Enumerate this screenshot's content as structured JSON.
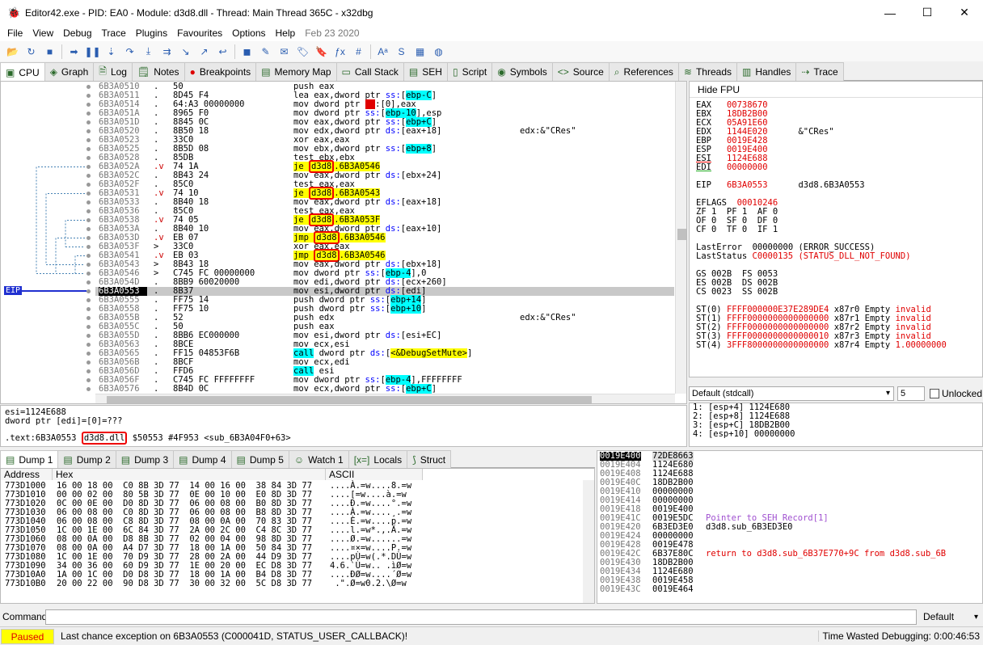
{
  "window": {
    "title": "Editor42.exe - PID: EA0 - Module: d3d8.dll - Thread: Main Thread 365C - x32dbg",
    "min": "—",
    "max": "☐",
    "close": "✕"
  },
  "menu": [
    "File",
    "View",
    "Debug",
    "Trace",
    "Plugins",
    "Favourites",
    "Options",
    "Help"
  ],
  "menu_date": "Feb 23 2020",
  "toolbar_icons": [
    "open-icon",
    "restart-icon",
    "stop-icon",
    "run-icon",
    "pause-icon",
    "step-into-icon",
    "step-over-icon",
    "run-to-user-icon",
    "animate-icon",
    "trace-into-icon",
    "trace-over-icon",
    "execute-till-return-icon",
    "scylla-icon",
    "patch-icon",
    "comment-icon",
    "label-icon",
    "bookmark-icon",
    "function-icon",
    "hash-icon",
    "font-icon",
    "string-icon",
    "calculator-icon",
    "help-icon"
  ],
  "tabs": [
    "CPU",
    "Graph",
    "Log",
    "Notes",
    "Breakpoints",
    "Memory Map",
    "Call Stack",
    "SEH",
    "Script",
    "Symbols",
    "Source",
    "References",
    "Threads",
    "Handles",
    "Trace"
  ],
  "disasm": [
    {
      "addr": "6B3A0510",
      "mk": ".",
      "bytes": "50",
      "instr": [
        [
          "push eax",
          ""
        ]
      ],
      "cmt": ""
    },
    {
      "addr": "6B3A0511",
      "mk": ".",
      "bytes": "8D45 F4",
      "instr": [
        [
          "lea eax,dword ptr ",
          ""
        ],
        [
          "ss:",
          "seg"
        ],
        [
          "[",
          ""
        ],
        [
          "ebp-C",
          "hl-c"
        ],
        [
          "]",
          ""
        ]
      ],
      "cmt": ""
    },
    {
      "addr": "6B3A0514",
      "mk": ".",
      "bytes": "64:A3 00000000",
      "instr": [
        [
          "mov dword ptr ",
          ""
        ],
        [
          "fs",
          "redbg"
        ],
        [
          ":[0],eax",
          ""
        ]
      ],
      "cmt": ""
    },
    {
      "addr": "6B3A051A",
      "mk": ".",
      "bytes": "8965 F0",
      "instr": [
        [
          "mov dword ptr ",
          ""
        ],
        [
          "ss:",
          "seg"
        ],
        [
          "[",
          ""
        ],
        [
          "ebp-10",
          "hl-c"
        ],
        [
          "],esp",
          ""
        ]
      ],
      "cmt": ""
    },
    {
      "addr": "6B3A051D",
      "mk": ".",
      "bytes": "8845 0C",
      "instr": [
        [
          "mov eax,dword ptr ",
          ""
        ],
        [
          "ss:",
          "seg"
        ],
        [
          "[",
          ""
        ],
        [
          "ebp+C",
          "hl-c"
        ],
        [
          "]",
          ""
        ]
      ],
      "cmt": ""
    },
    {
      "addr": "6B3A0520",
      "mk": ".",
      "bytes": "8B50 18",
      "instr": [
        [
          "mov edx,dword ptr ",
          ""
        ],
        [
          "ds:",
          "seg"
        ],
        [
          "[eax+18]",
          ""
        ]
      ],
      "cmt": "edx:&\"CRes\""
    },
    {
      "addr": "6B3A0523",
      "mk": ".",
      "bytes": "33C0",
      "instr": [
        [
          "xor eax,eax",
          ""
        ]
      ],
      "cmt": ""
    },
    {
      "addr": "6B3A0525",
      "mk": ".",
      "bytes": "8B5D 08",
      "instr": [
        [
          "mov ebx,dword ptr ",
          ""
        ],
        [
          "ss:",
          "seg"
        ],
        [
          "[",
          ""
        ],
        [
          "ebp+8",
          "hl-c"
        ],
        [
          "]",
          ""
        ]
      ],
      "cmt": ""
    },
    {
      "addr": "6B3A0528",
      "mk": ".",
      "bytes": "85DB",
      "instr": [
        [
          "test ebx,ebx",
          ""
        ]
      ],
      "cmt": ""
    },
    {
      "addr": "6B3A052A",
      "mk": ".v",
      "bytes": "74 1A",
      "instr": [
        [
          "je ",
          "jk"
        ],
        [
          "d3d8",
          "box"
        ],
        [
          ".6B3A0546",
          "hl-y"
        ]
      ],
      "cmt": ""
    },
    {
      "addr": "6B3A052C",
      "mk": ".",
      "bytes": "8B43 24",
      "instr": [
        [
          "mov eax,dword ptr ",
          ""
        ],
        [
          "ds:",
          "seg"
        ],
        [
          "[ebx+24]",
          ""
        ]
      ],
      "cmt": ""
    },
    {
      "addr": "6B3A052F",
      "mk": ".",
      "bytes": "85C0",
      "instr": [
        [
          "test eax,eax",
          ""
        ]
      ],
      "cmt": ""
    },
    {
      "addr": "6B3A0531",
      "mk": ".v",
      "bytes": "74 10",
      "instr": [
        [
          "je ",
          "jk"
        ],
        [
          "d3d8",
          "box"
        ],
        [
          ".6B3A0543",
          "hl-y"
        ]
      ],
      "cmt": ""
    },
    {
      "addr": "6B3A0533",
      "mk": ".",
      "bytes": "8B40 18",
      "instr": [
        [
          "mov eax,dword ptr ",
          ""
        ],
        [
          "ds:",
          "seg"
        ],
        [
          "[eax+18]",
          ""
        ]
      ],
      "cmt": ""
    },
    {
      "addr": "6B3A0536",
      "mk": ".",
      "bytes": "85C0",
      "instr": [
        [
          "test eax,eax",
          ""
        ]
      ],
      "cmt": ""
    },
    {
      "addr": "6B3A0538",
      "mk": ".v",
      "bytes": "74 05",
      "instr": [
        [
          "je ",
          "jk"
        ],
        [
          "d3d8",
          "box"
        ],
        [
          ".6B3A053F",
          "hl-y"
        ]
      ],
      "cmt": ""
    },
    {
      "addr": "6B3A053A",
      "mk": ".",
      "bytes": "8B40 10",
      "instr": [
        [
          "mov eax,dword ptr ",
          ""
        ],
        [
          "ds:",
          "seg"
        ],
        [
          "[eax+10]",
          ""
        ]
      ],
      "cmt": ""
    },
    {
      "addr": "6B3A053D",
      "mk": ".v",
      "bytes": "EB 07",
      "instr": [
        [
          "jmp ",
          "jk"
        ],
        [
          "d3d8",
          "box"
        ],
        [
          ".6B3A0546",
          "hl-y"
        ]
      ],
      "cmt": ""
    },
    {
      "addr": "6B3A053F",
      "mk": ">",
      "bytes": "33C0",
      "instr": [
        [
          "xor eax,eax",
          ""
        ]
      ],
      "cmt": ""
    },
    {
      "addr": "6B3A0541",
      "mk": ".v",
      "bytes": "EB 03",
      "instr": [
        [
          "jmp ",
          "jk"
        ],
        [
          "d3d8",
          "box"
        ],
        [
          ".6B3A0546",
          "hl-y"
        ]
      ],
      "cmt": ""
    },
    {
      "addr": "6B3A0543",
      "mk": ">",
      "bytes": "8B43 18",
      "instr": [
        [
          "mov eax,dword ptr ",
          ""
        ],
        [
          "ds:",
          "seg"
        ],
        [
          "[ebx+18]",
          ""
        ]
      ],
      "cmt": ""
    },
    {
      "addr": "6B3A0546",
      "mk": ">",
      "bytes": "C745 FC 00000000",
      "instr": [
        [
          "mov dword ptr ",
          ""
        ],
        [
          "ss:",
          "seg"
        ],
        [
          "[",
          ""
        ],
        [
          "ebp-4",
          "hl-c"
        ],
        [
          "],0",
          ""
        ]
      ],
      "cmt": ""
    },
    {
      "addr": "6B3A054D",
      "mk": ".",
      "bytes": "8BB9 60020000",
      "instr": [
        [
          "mov edi,dword ptr ",
          ""
        ],
        [
          "ds:",
          "seg"
        ],
        [
          "[ecx+260]",
          ""
        ]
      ],
      "cmt": ""
    },
    {
      "addr": "6B3A0553",
      "mk": ".",
      "bytes": "8B37",
      "instr": [
        [
          "mov esi,dword ptr ",
          ""
        ],
        [
          "ds:",
          "seg"
        ],
        [
          "[edi]",
          ""
        ]
      ],
      "cmt": "",
      "cur": true
    },
    {
      "addr": "6B3A0555",
      "mk": ".",
      "bytes": "FF75 14",
      "instr": [
        [
          "push dword ptr ",
          ""
        ],
        [
          "ss:",
          "seg"
        ],
        [
          "[",
          ""
        ],
        [
          "ebp+14",
          "hl-c"
        ],
        [
          "]",
          ""
        ]
      ],
      "cmt": ""
    },
    {
      "addr": "6B3A0558",
      "mk": ".",
      "bytes": "FF75 10",
      "instr": [
        [
          "push dword ptr ",
          ""
        ],
        [
          "ss:",
          "seg"
        ],
        [
          "[",
          ""
        ],
        [
          "ebp+10",
          "hl-c"
        ],
        [
          "]",
          ""
        ]
      ],
      "cmt": ""
    },
    {
      "addr": "6B3A055B",
      "mk": ".",
      "bytes": "52",
      "instr": [
        [
          "push edx",
          ""
        ]
      ],
      "cmt": "edx:&\"CRes\""
    },
    {
      "addr": "6B3A055C",
      "mk": ".",
      "bytes": "50",
      "instr": [
        [
          "push eax",
          ""
        ]
      ],
      "cmt": ""
    },
    {
      "addr": "6B3A055D",
      "mk": ".",
      "bytes": "8BB6 EC000000",
      "instr": [
        [
          "mov esi,dword ptr ",
          ""
        ],
        [
          "ds:",
          "seg"
        ],
        [
          "[esi+EC]",
          ""
        ]
      ],
      "cmt": ""
    },
    {
      "addr": "6B3A0563",
      "mk": ".",
      "bytes": "8BCE",
      "instr": [
        [
          "mov ecx,esi",
          ""
        ]
      ],
      "cmt": ""
    },
    {
      "addr": "6B3A0565",
      "mk": ".",
      "bytes": "FF15 04853F6B",
      "instr": [
        [
          "call",
          "hl-c"
        ],
        [
          " dword ptr ",
          ""
        ],
        [
          "ds:",
          "seg"
        ],
        [
          "[",
          ""
        ],
        [
          "<&DebugSetMute>",
          "hl-y"
        ],
        [
          "]",
          ""
        ]
      ],
      "cmt": ""
    },
    {
      "addr": "6B3A056B",
      "mk": ".",
      "bytes": "8BCF",
      "instr": [
        [
          "mov ecx,edi",
          ""
        ]
      ],
      "cmt": ""
    },
    {
      "addr": "6B3A056D",
      "mk": ".",
      "bytes": "FFD6",
      "instr": [
        [
          "call",
          "hl-c"
        ],
        [
          " esi",
          ""
        ]
      ],
      "cmt": ""
    },
    {
      "addr": "6B3A056F",
      "mk": ".",
      "bytes": "C745 FC FFFFFFFF",
      "instr": [
        [
          "mov dword ptr ",
          ""
        ],
        [
          "ss:",
          "seg"
        ],
        [
          "[",
          ""
        ],
        [
          "ebp-4",
          "hl-c"
        ],
        [
          "],FFFFFFFF",
          ""
        ]
      ],
      "cmt": ""
    },
    {
      "addr": "6B3A0576",
      "mk": ".",
      "bytes": "8B4D 0C",
      "instr": [
        [
          "mov ecx,dword ptr ",
          ""
        ],
        [
          "ss:",
          "seg"
        ],
        [
          "[",
          ""
        ],
        [
          "ebp+C",
          "hl-c"
        ],
        [
          "]",
          ""
        ]
      ],
      "cmt": ""
    }
  ],
  "eip_label": "EIP",
  "info": {
    "line1": "esi=1124E688",
    "line2": "dword ptr [edi]=[0]=???",
    "line3_pre": ".text:6B3A0553 ",
    "line3_mod": "d3d8.dll",
    "line3_post": " $50553 #4F953 <sub_6B3A04F0+63>"
  },
  "fpu": {
    "header": "Hide FPU",
    "gp": [
      [
        "EAX",
        "00738670",
        ""
      ],
      [
        "EBX",
        "18DB2B00",
        ""
      ],
      [
        "ECX",
        "05A91E60",
        ""
      ],
      [
        "EDX",
        "1144E020",
        "&\"CRes\""
      ],
      [
        "EBP",
        "0019E428",
        ""
      ],
      [
        "ESP",
        "0019E400",
        ""
      ],
      [
        "ESI",
        "1124E688",
        ""
      ],
      [
        "EDI",
        "00000000",
        ""
      ]
    ],
    "eip": [
      "EIP",
      "6B3A0553",
      "d3d8.6B3A0553"
    ],
    "eflags": [
      "EFLAGS",
      "00010246"
    ],
    "flags": [
      "ZF 1  PF 1  AF 0",
      "OF 0  SF 0  DF 0",
      "CF 0  TF 0  IF 1"
    ],
    "lasterror": [
      "LastError",
      "00000000 (ERROR_SUCCESS)"
    ],
    "laststatus": [
      "LastStatus",
      "C0000135 (STATUS_DLL_NOT_FOUND)"
    ],
    "segs": [
      "GS 002B  FS 0053",
      "ES 002B  DS 002B",
      "CS 0023  SS 002B"
    ],
    "st": [
      [
        "ST(0)",
        "FFFF000000E37E289DE4",
        "x87r0",
        "Empty",
        "invalid"
      ],
      [
        "ST(1)",
        "FFFF0000000000000000",
        "x87r1",
        "Empty",
        "invalid"
      ],
      [
        "ST(2)",
        "FFFF0000000000000000",
        "x87r2",
        "Empty",
        "invalid"
      ],
      [
        "ST(3)",
        "FFFF0000000000000010",
        "x87r3",
        "Empty",
        "invalid"
      ],
      [
        "ST(4)",
        "3FFF8000000000000000",
        "x87r4",
        "Empty",
        "1.00000000"
      ]
    ]
  },
  "callconv": {
    "value": "Default (stdcall)",
    "count": "5",
    "unlocked": "Unlocked"
  },
  "args": [
    "1: [esp+4] 1124E680",
    "2: [esp+8] 1124E688",
    "3: [esp+C] 18DB2B00",
    "4: [esp+10] 00000000"
  ],
  "dumptabs": [
    "Dump 1",
    "Dump 2",
    "Dump 3",
    "Dump 4",
    "Dump 5",
    "Watch 1",
    "Locals",
    "Struct"
  ],
  "dump": {
    "h_addr": "Address",
    "h_hex": "Hex",
    "h_ascii": "ASCII",
    "rows": [
      [
        "773D1000",
        "16 00 18 00  C0 8B 3D 77  14 00 16 00  38 84 3D 77",
        "....À.=w....8.=w"
      ],
      [
        "773D1010",
        "00 00 02 00  80 5B 3D 77  0E 00 10 00  E0 8D 3D 77",
        "....[=w....à.=w"
      ],
      [
        "773D1020",
        "0C 00 0E 00  D0 8D 3D 77  06 00 08 00  B0 8D 3D 77",
        "....Ð.=w....°.=w"
      ],
      [
        "773D1030",
        "06 00 08 00  C0 8D 3D 77  06 00 08 00  B8 8D 3D 77",
        "....À.=w....¸.=w"
      ],
      [
        "773D1040",
        "06 00 08 00  C8 8D 3D 77  08 00 0A 00  70 83 3D 77",
        "....È.=w....p.=w"
      ],
      [
        "773D1050",
        "1C 00 1E 00  6C 84 3D 77  2A 00 2C 00  C4 8C 3D 77",
        "....l.=w*.,.Ä.=w"
      ],
      [
        "773D1060",
        "08 00 0A 00  D8 8B 3D 77  02 00 04 00  98 8D 3D 77",
        "....Ø.=w......=w"
      ],
      [
        "773D1070",
        "08 00 0A 00  A4 D7 3D 77  18 00 1A 00  50 84 3D 77",
        "....¤×=w....P.=w"
      ],
      [
        "773D1080",
        "1C 00 1E 00  70 D9 3D 77  28 00 2A 00  44 D9 3D 77",
        "....pÙ=w(.*.DÙ=w"
      ],
      [
        "773D1090",
        "34 00 36 00  60 D9 3D 77  1E 00 20 00  EC D8 3D 77",
        "4.6.`Ù=w.. .ìØ=w"
      ],
      [
        "773D10A0",
        "1A 00 1C 00  D0 D8 3D 77  18 00 1A 00  B4 D8 3D 77",
        "....ÐØ=w....´Ø=w"
      ],
      [
        "773D10B0",
        "20 00 22 00  90 D8 3D 77  30 00 32 00  5C D8 3D 77",
        " .\".Ø=w0.2.\\Ø=w"
      ]
    ]
  },
  "stack": [
    [
      "0019E400",
      "72DE8663",
      "",
      true
    ],
    [
      "0019E404",
      "1124E680",
      ""
    ],
    [
      "0019E408",
      "1124E688",
      ""
    ],
    [
      "0019E40C",
      "18DB2B00",
      ""
    ],
    [
      "0019E410",
      "00000000",
      ""
    ],
    [
      "0019E414",
      "00000000",
      ""
    ],
    [
      "0019E418",
      "0019E400",
      ""
    ],
    [
      "0019E41C",
      "0019E5DC",
      "Pointer to SEH_Record[1]"
    ],
    [
      "0019E420",
      "6B3ED3E0",
      "d3d8.sub_6B3ED3E0"
    ],
    [
      "0019E424",
      "00000000",
      ""
    ],
    [
      "0019E428",
      "0019E478",
      ""
    ],
    [
      "0019E42C",
      "6B37E80C",
      "return to d3d8.sub_6B37E770+9C from d3d8.sub_6B"
    ],
    [
      "0019E430",
      "18DB2B00",
      ""
    ],
    [
      "0019E434",
      "1124E680",
      ""
    ],
    [
      "0019E438",
      "0019E458",
      ""
    ],
    [
      "0019E43C",
      "0019E464",
      ""
    ]
  ],
  "cmd": {
    "label": "Command:",
    "value": "",
    "mode": "Default"
  },
  "status": {
    "state": "Paused",
    "message": "Last chance exception on 6B3A0553 (C000041D, STATUS_USER_CALLBACK)!",
    "time": "Time Wasted Debugging: 0:00:46:53"
  }
}
